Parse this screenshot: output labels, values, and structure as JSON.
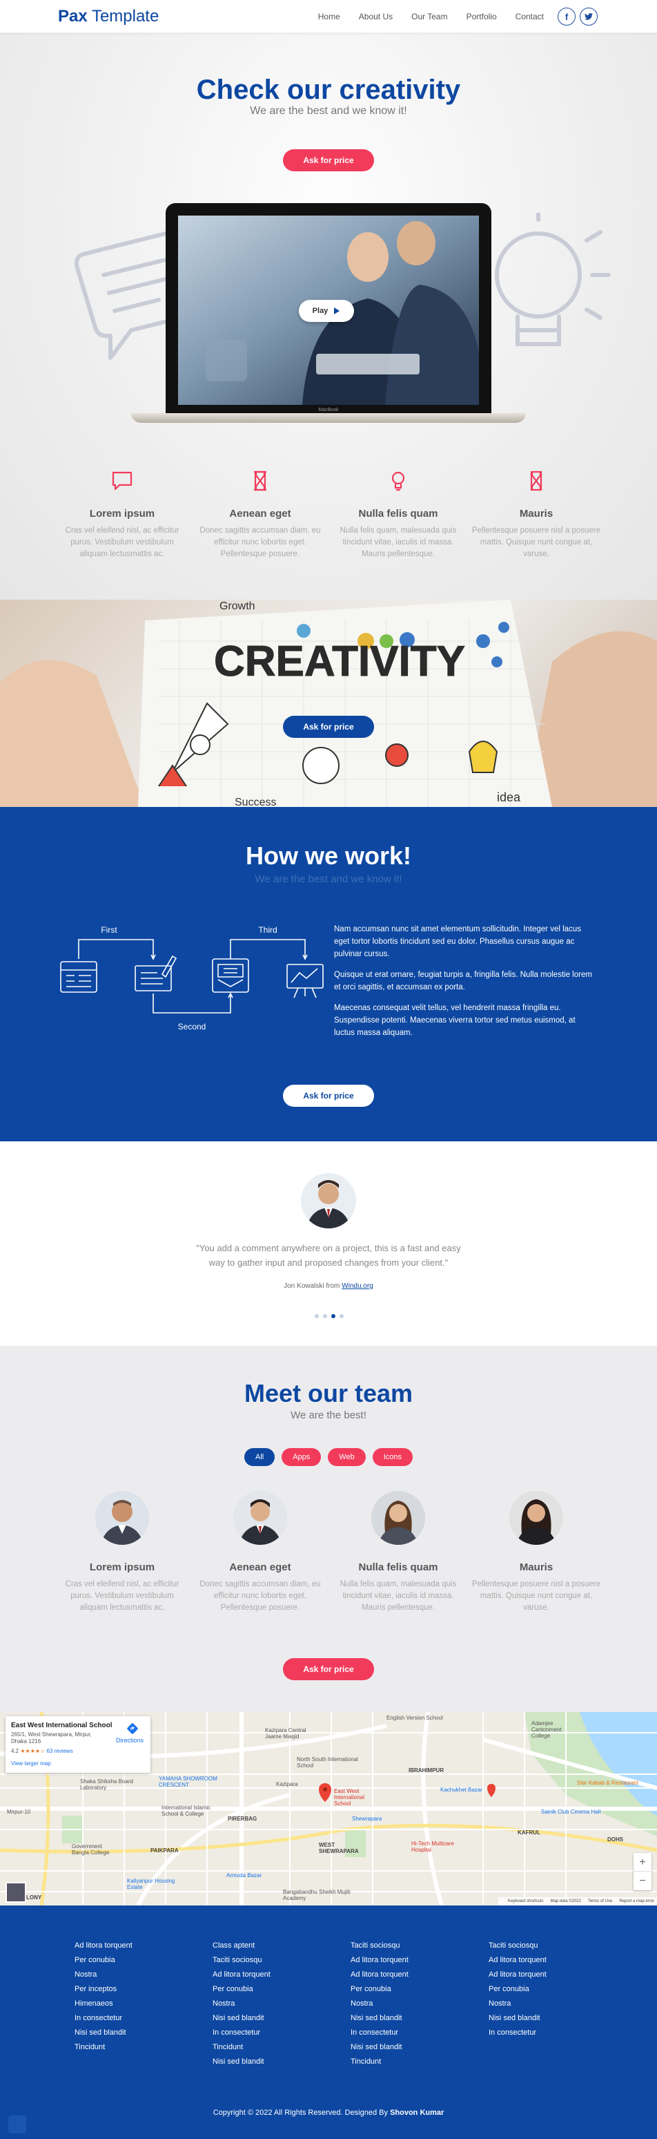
{
  "header": {
    "logo_bold": "Pax",
    "logo_rest": " Template",
    "nav": [
      "Home",
      "About Us",
      "Our Team",
      "Portfolio",
      "Contact"
    ],
    "social": [
      "f",
      "t"
    ]
  },
  "hero": {
    "title": "Check our creativity",
    "subtitle": "We are the best and we know it!",
    "cta": "Ask for price",
    "play_label": "Play",
    "laptop_brand": "MacBook"
  },
  "features": [
    {
      "title": "Lorem ipsum",
      "text": "Cras vel eleifend nisl, ac efficitur purus. Vestibulum vestibulum aliquam lectusmattis ac.",
      "icon": "chat-bubble-icon"
    },
    {
      "title": "Aenean eget",
      "text": "Donec sagittis accumsan diam, eu efficitur nunc lobortis eget. Pellentesque posuere.",
      "icon": "hourglass-icon"
    },
    {
      "title": "Nulla felis quam",
      "text": "Nulla felis quam, malesuada quis tincidunt vitae, iaculis id massa. Mauris pellentesque.",
      "icon": "lightbulb-icon"
    },
    {
      "title": "Mauris",
      "text": "Pellentesque posuere nisl a posuere mattis. Quisque nunt congue at, varuse.",
      "icon": "hourglass-icon"
    }
  ],
  "creativity": {
    "word": "CREATIVITY",
    "cta": "Ask for price",
    "doodles": [
      "Growth",
      "Success",
      "idea"
    ]
  },
  "how": {
    "title": "How we work!",
    "subtitle": "We are the best and we know it!",
    "steps": [
      "First",
      "Second",
      "Third"
    ],
    "paragraphs": [
      "Nam accumsan nunc sit amet elementum sollicitudin. Integer vel lacus eget tortor lobortis tincidunt sed eu dolor. Phasellus cursus augue ac pulvinar cursus.",
      "Quisque ut erat ornare, feugiat turpis a, fringilla felis. Nulla molestie lorem et orci sagittis, et accumsan ex porta.",
      "Maecenas consequat velit tellus, vel hendrerit massa fringilla eu. Suspendisse potenti. Maecenas viverra tortor sed metus euismod, at luctus massa aliquam."
    ],
    "cta": "Ask for price"
  },
  "testimonial": {
    "quote": "\"You add a comment anywhere on a project, this is a fast and easy way to gather input and proposed changes from your client.\"",
    "author": "Jon Kowalski from ",
    "author_link": "Windu.org"
  },
  "team": {
    "title": "Meet our team",
    "subtitle": "We are the best!",
    "filters": [
      "All",
      "Apps",
      "Web",
      "Icons"
    ],
    "members": [
      {
        "name": "Lorem ipsum",
        "text": "Cras vel eleifend nisl, ac efficitur purus. Vestibulum vestibulum aliquam lectusmattis ac."
      },
      {
        "name": "Aenean eget",
        "text": "Donec sagittis accumsan diam, eu efficitur nunc lobortis eget. Pellentesque posuere."
      },
      {
        "name": "Nulla felis quam",
        "text": "Nulla felis quam, malesuada quis tincidunt vitae, iaculis id massa. Mauris pellentesque."
      },
      {
        "name": "Mauris",
        "text": "Pellentesque posuere nisl a posuere mattis. Quisque nunt congue at, varuse."
      }
    ],
    "cta": "Ask for price"
  },
  "map": {
    "place": "East West International School",
    "address": "265/1, West Shewrapara, Mirpur, Dhaka 1216",
    "rating": "4.2",
    "stars": "★★★★☆",
    "reviews": "63 reviews",
    "larger": "View larger map",
    "directions": "Directions",
    "labels": [
      "English Version School",
      "Kazipara Central Jaame Masjid",
      "Adamjee Cantonment College",
      "North South International School",
      "IBRAHIMPUR",
      "YAMAHA SHOWROOM CRESCENT",
      "Shaka Shiksha Board Laboratory",
      "International Islamic School & College",
      "Kazipara",
      "East West International School",
      "Kachukhet Bazar",
      "Star Kabab & Restaurant",
      "Sainik Club Cinema Hall",
      "Mirpur-10",
      "PIRERBAG",
      "Shewrapara",
      "Government Bangla College",
      "PAIKPARA",
      "WEST SHEWRAPARA",
      "Hi-Tech Multicare Hospital",
      "Kallyanpur Housing Estate",
      "Armoda Bazar",
      "Bangabandhu Sheikh Mujib Academy",
      "KAFRUL",
      "DOHS",
      "LONY"
    ],
    "footer": [
      "Keyboard shortcuts",
      "Map data ©2022",
      "Terms of Use",
      "Report a map error"
    ],
    "zoom_in": "+",
    "zoom_out": "−"
  },
  "footer": {
    "columns": [
      [
        "Ad litora torquent",
        "Per conubia",
        "Nostra",
        "Per inceptos",
        "Himenaeos",
        "In consectetur",
        "Nisi sed blandit",
        "Tincidunt"
      ],
      [
        "Class aptent",
        "Taciti sociosqu",
        "Ad litora torquent",
        "Per conubia",
        "Nostra",
        "Nisi sed blandit",
        "In consectetur",
        "Tincidunt",
        "Nisi sed blandit"
      ],
      [
        "Taciti sociosqu",
        "Ad litora torquent",
        "Ad litora torquent",
        "Per conubia",
        "Nostra",
        "Nisi sed blandit",
        "In consectetur",
        "Nisi sed blandit",
        "Tincidunt"
      ],
      [
        "Taciti sociosqu",
        "Ad litora torquent",
        "Ad litora torquent",
        "Per conubia",
        "Nostra",
        "Nisi sed blandit",
        "In consectetur"
      ]
    ],
    "copyright": "Copyright © 2022 All Rights Reserved. Designed By ",
    "designer": "Shovon Kumar"
  },
  "colors": {
    "brand_blue": "#0d47a1",
    "accent_red": "#f23b5b",
    "text_gray": "#aaaaaa"
  }
}
